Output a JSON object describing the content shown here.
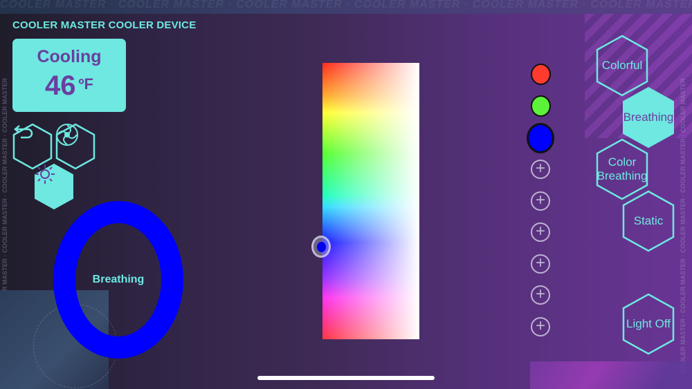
{
  "app_title": "COOLER MASTER COOLER DEVICE",
  "status": {
    "mode_label": "Cooling",
    "temperature": "46",
    "unit": "ºF"
  },
  "nav_icons": [
    "back-icon",
    "fan-icon",
    "brightness-icon"
  ],
  "preview": {
    "label": "Breathing",
    "color": "#0000ff"
  },
  "color_slots": [
    {
      "color": "#ff3b2f",
      "selected": false
    },
    {
      "color": "#5cf23a",
      "selected": false
    },
    {
      "color": "#0000ff",
      "selected": true
    }
  ],
  "add_slot_label": "+",
  "modes": {
    "colorful": "Colorful",
    "breathing": "Breathing",
    "color_breathing": "Color Breathing",
    "static": "Static",
    "light_off": "Light Off",
    "active": "breathing"
  },
  "colors": {
    "accent": "#6ee8e0",
    "text_purple": "#6a3fa0"
  }
}
